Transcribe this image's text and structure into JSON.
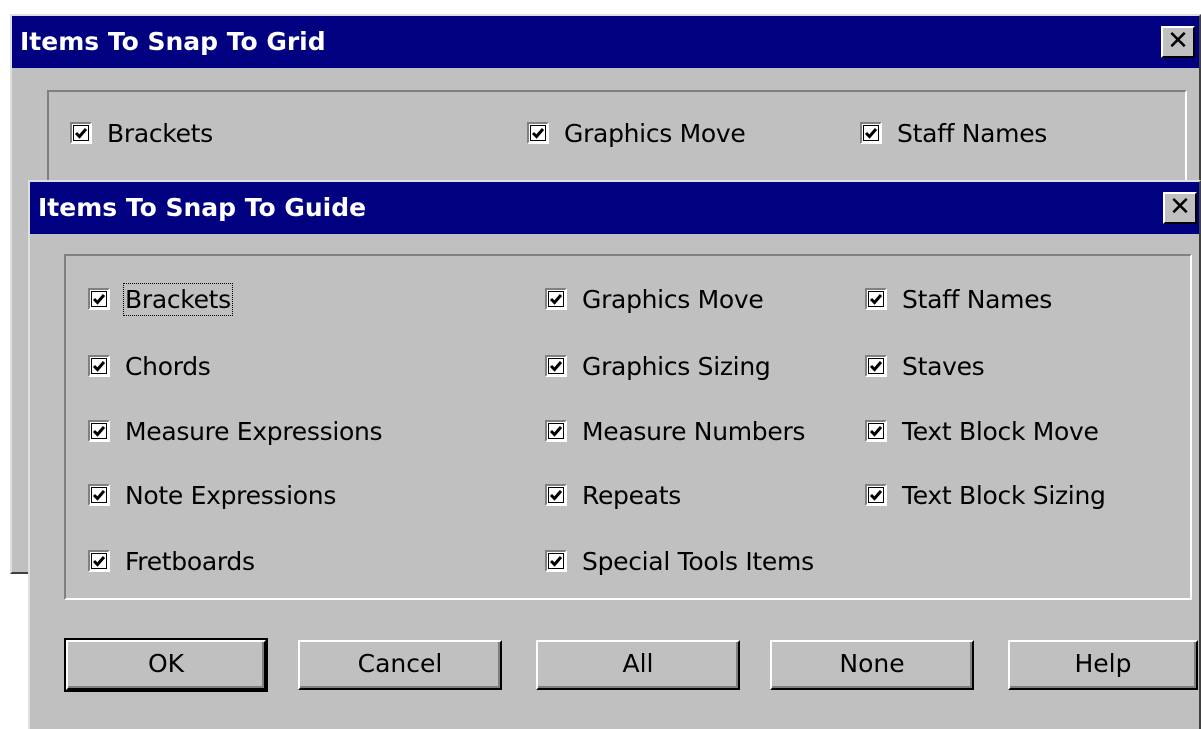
{
  "grid_dialog": {
    "title": "Items To Snap To Grid",
    "close_glyph": "✕",
    "options": [
      {
        "label": "Brackets",
        "checked": true
      },
      {
        "label": "Graphics Move",
        "checked": true
      },
      {
        "label": "Staff Names",
        "checked": true
      }
    ]
  },
  "guide_dialog": {
    "title": "Items To Snap To Guide",
    "close_glyph": "✕",
    "options": [
      {
        "label": "Brackets",
        "checked": true
      },
      {
        "label": "Graphics Move",
        "checked": true
      },
      {
        "label": "Staff Names",
        "checked": true
      },
      {
        "label": "Chords",
        "checked": true
      },
      {
        "label": "Graphics Sizing",
        "checked": true
      },
      {
        "label": "Staves",
        "checked": true
      },
      {
        "label": "Measure Expressions",
        "checked": true
      },
      {
        "label": "Measure Numbers",
        "checked": true
      },
      {
        "label": "Text Block Move",
        "checked": true
      },
      {
        "label": "Note Expressions",
        "checked": true
      },
      {
        "label": "Repeats",
        "checked": true
      },
      {
        "label": "Text Block Sizing",
        "checked": true
      },
      {
        "label": "Fretboards",
        "checked": true
      },
      {
        "label": "Special Tools Items",
        "checked": true
      }
    ],
    "buttons": {
      "ok": "OK",
      "cancel": "Cancel",
      "all": "All",
      "none": "None",
      "help": "Help"
    }
  },
  "colors": {
    "titlebar": "#000080",
    "face": "#c0c0c0"
  }
}
